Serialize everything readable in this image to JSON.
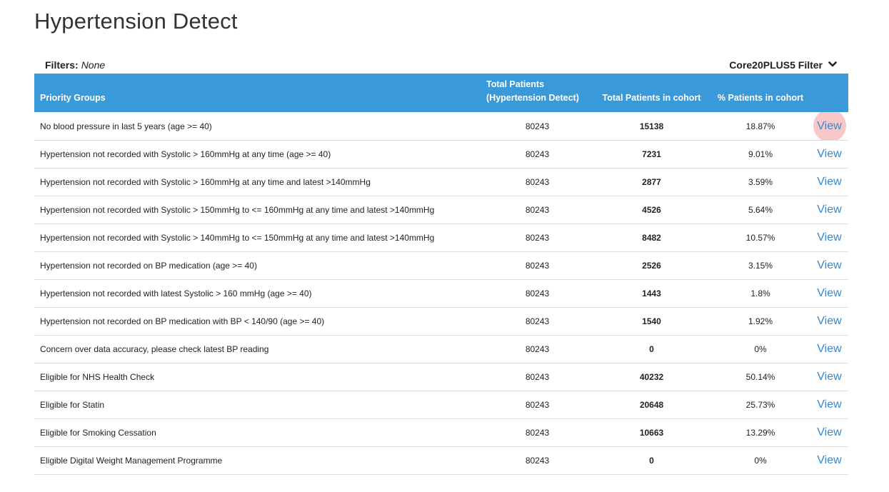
{
  "page": {
    "title": "Hypertension Detect"
  },
  "filters": {
    "label": "Filters:",
    "value": "None",
    "core_filter_label": "Core20PLUS5 Filter",
    "core_filter_icon": "chevron-down-icon"
  },
  "table": {
    "headers": {
      "priority_groups": "Priority Groups",
      "total_patients_line1": "Total Patients",
      "total_patients_line2": "(Hypertension Detect)",
      "total_in_cohort": "Total Patients in cohort",
      "pct_in_cohort": "% Patients in cohort"
    },
    "header_color": "#3a9ad9",
    "link_color": "#3a87c8",
    "rows": [
      {
        "group": "No blood pressure in last 5 years (age >= 40)",
        "total": "80243",
        "cohort": "15138",
        "pct": "18.87%",
        "action": "View",
        "hovered": true
      },
      {
        "group": "Hypertension not recorded with Systolic > 160mmHg at any time (age >= 40)",
        "total": "80243",
        "cohort": "7231",
        "pct": "9.01%",
        "action": "View"
      },
      {
        "group": "Hypertension not recorded with Systolic > 160mmHg at any time and latest >140mmHg",
        "total": "80243",
        "cohort": "2877",
        "pct": "3.59%",
        "action": "View"
      },
      {
        "group": "Hypertension not recorded with Systolic > 150mmHg to <= 160mmHg at any time and latest >140mmHg",
        "total": "80243",
        "cohort": "4526",
        "pct": "5.64%",
        "action": "View"
      },
      {
        "group": "Hypertension not recorded with Systolic > 140mmHg to <= 150mmHg at any time and latest >140mmHg",
        "total": "80243",
        "cohort": "8482",
        "pct": "10.57%",
        "action": "View"
      },
      {
        "group": "Hypertension not recorded on BP medication (age >= 40)",
        "total": "80243",
        "cohort": "2526",
        "pct": "3.15%",
        "action": "View"
      },
      {
        "group": "Hypertension not recorded with latest Systolic > 160 mmHg (age >= 40)",
        "total": "80243",
        "cohort": "1443",
        "pct": "1.8%",
        "action": "View"
      },
      {
        "group": "Hypertension not recorded on BP medication with BP < 140/90 (age >= 40)",
        "total": "80243",
        "cohort": "1540",
        "pct": "1.92%",
        "action": "View"
      },
      {
        "group": "Concern over data accuracy, please check latest BP reading",
        "total": "80243",
        "cohort": "0",
        "pct": "0%",
        "action": "View"
      },
      {
        "group": "Eligible for NHS Health Check",
        "total": "80243",
        "cohort": "40232",
        "pct": "50.14%",
        "action": "View"
      },
      {
        "group": "Eligible for Statin",
        "total": "80243",
        "cohort": "20648",
        "pct": "25.73%",
        "action": "View"
      },
      {
        "group": "Eligible for Smoking Cessation",
        "total": "80243",
        "cohort": "10663",
        "pct": "13.29%",
        "action": "View"
      },
      {
        "group": "Eligible Digital Weight Management Programme",
        "total": "80243",
        "cohort": "0",
        "pct": "0%",
        "action": "View"
      }
    ]
  }
}
